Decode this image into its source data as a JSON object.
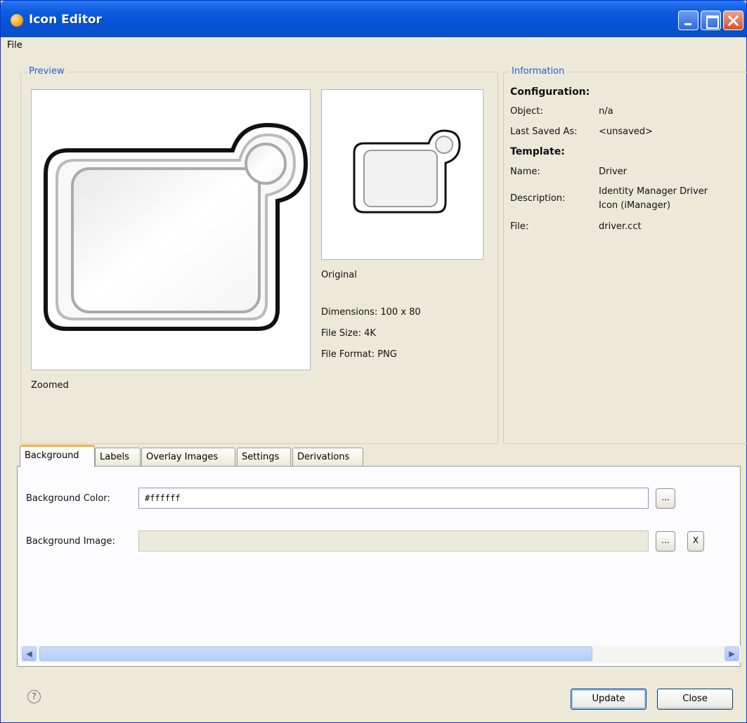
{
  "window": {
    "title": "Icon Editor"
  },
  "menu": {
    "file": "File"
  },
  "preview": {
    "legend": "Preview",
    "zoomed_label": "Zoomed",
    "original_label": "Original",
    "dimensions": "Dimensions: 100 x 80",
    "file_size": "File Size: 4K",
    "file_format": "File Format: PNG"
  },
  "information": {
    "legend": "Information",
    "configuration_heading": "Configuration:",
    "object_label": "Object:",
    "object_value": "n/a",
    "last_saved_label": "Last Saved As:",
    "last_saved_value": "<unsaved>",
    "template_heading": "Template:",
    "name_label": "Name:",
    "name_value": "Driver",
    "description_label": "Description:",
    "description_line1": "Identity Manager Driver",
    "description_line2": "Icon (iManager)",
    "file_label": "File:",
    "file_value": "driver.cct"
  },
  "tabs": [
    {
      "label": "Background",
      "active": true
    },
    {
      "label": "Labels",
      "active": false
    },
    {
      "label": "Overlay Images",
      "active": false
    },
    {
      "label": "Settings",
      "active": false
    },
    {
      "label": "Derivations",
      "active": false
    }
  ],
  "background_tab": {
    "color_label": "Background Color:",
    "color_value": "#ffffff",
    "image_label": "Background Image:",
    "image_value": "",
    "browse_label": "...",
    "clear_label": "X"
  },
  "footer": {
    "help_glyph": "?",
    "update_label": "Update",
    "close_label": "Close"
  },
  "icons": [
    "app-icon",
    "minimize-icon",
    "maximize-icon",
    "close-icon",
    "help-icon",
    "scroll-left-icon",
    "scroll-right-icon"
  ]
}
